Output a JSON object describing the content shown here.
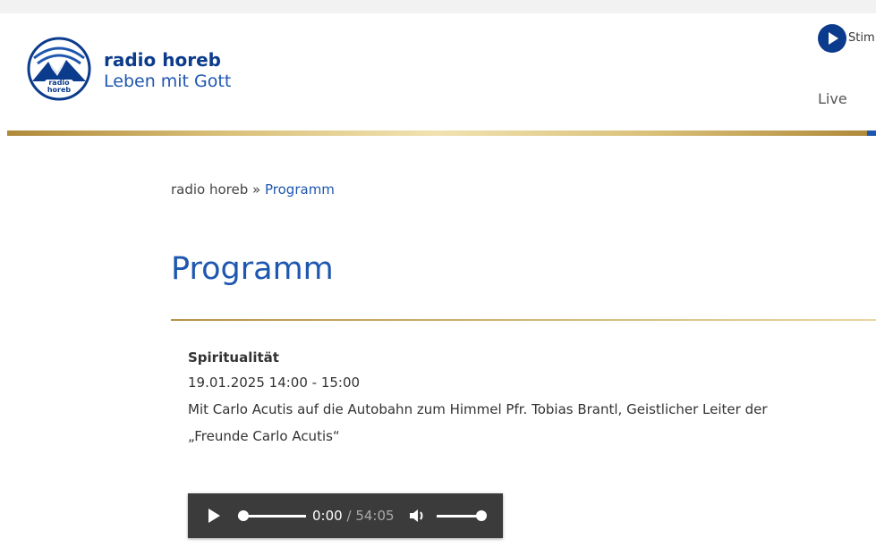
{
  "header": {
    "brand_name": "radio horeb",
    "tagline": "Leben mit Gott",
    "logo_text": "radio horeb",
    "stream_label": "Stim",
    "nav_live": "Live"
  },
  "breadcrumb": {
    "home": "radio horeb",
    "separator": "»",
    "current": "Programm"
  },
  "page_title": "Programm",
  "entry": {
    "category": "Spiritualität",
    "datetime": "19.01.2025 14:00 - 15:00",
    "description": "Mit Carlo Acutis auf die Autobahn zum Himmel Pfr. Tobias Brantl, Geistlicher Leiter der „Freunde Carlo Acutis“"
  },
  "player": {
    "current_time": "0:00",
    "separator": "/",
    "total_time": "54:05",
    "progress": 0,
    "volume": 1
  },
  "colors": {
    "brand_blue": "#0b3b8c",
    "link_blue": "#1f57b0",
    "gold": "#c9a85a",
    "player_bg": "#3b3b3b"
  },
  "icons": [
    "logo-icon",
    "play-icon",
    "volume-icon"
  ]
}
